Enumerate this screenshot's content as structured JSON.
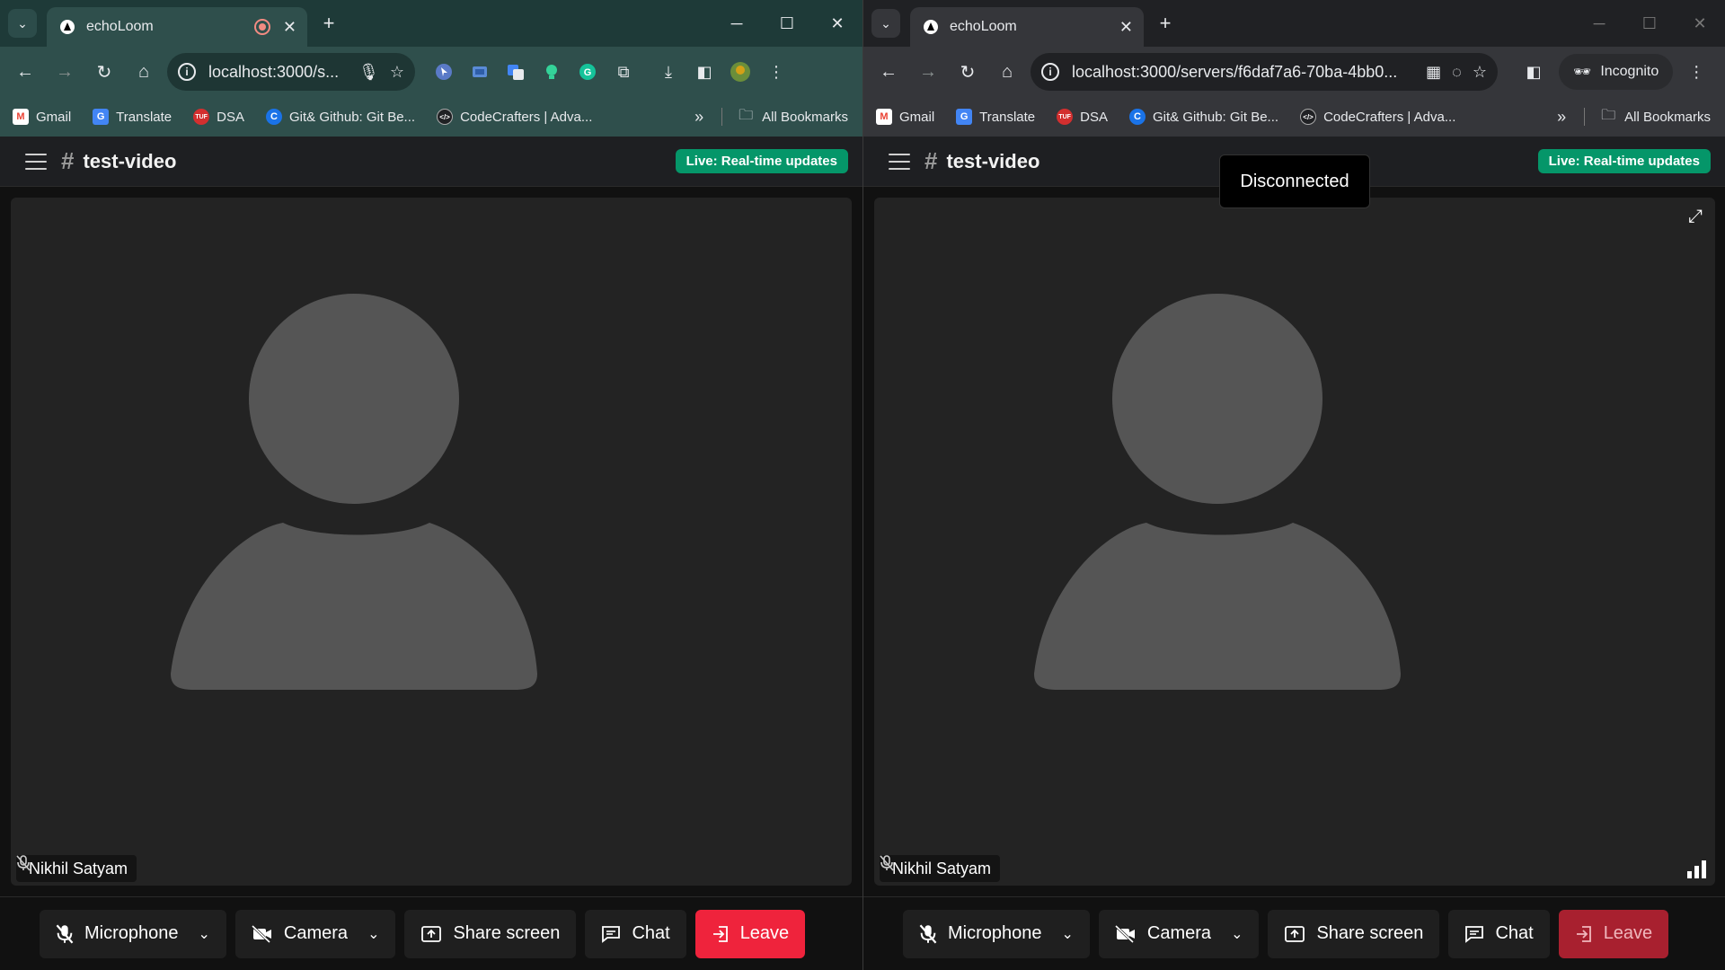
{
  "windows": [
    {
      "id": "left",
      "tab": {
        "title": "echoLoom",
        "recording": true
      },
      "url": "localhost:3000/s...",
      "bookmarks": [
        {
          "label": "Gmail",
          "icon": "gmail-icon",
          "color": "#ea4335"
        },
        {
          "label": "Translate",
          "icon": "translate-icon",
          "color": "#4285f4"
        },
        {
          "label": "DSA",
          "icon": "tuf-icon",
          "color": "#d32f2f"
        },
        {
          "label": "Git& Github: Git Be...",
          "icon": "git-course-icon",
          "color": "#1a73e8"
        },
        {
          "label": "CodeCrafters | Adva...",
          "icon": "codecrafters-icon",
          "color": "#202124"
        }
      ],
      "all_bookmarks": "All Bookmarks",
      "app": {
        "channel": "test-video",
        "live_badge": "Live: Real-time updates",
        "participant": "Nikhil Satyam",
        "toast": null,
        "controls": {
          "microphone": "Microphone",
          "camera": "Camera",
          "share_screen": "Share screen",
          "chat": "Chat",
          "leave": "Leave"
        }
      }
    },
    {
      "id": "right",
      "tab": {
        "title": "echoLoom",
        "recording": false
      },
      "url": "localhost:3000/servers/f6daf7a6-70ba-4bb0...",
      "incognito": "Incognito",
      "bookmarks": [
        {
          "label": "Gmail",
          "icon": "gmail-icon",
          "color": "#ea4335"
        },
        {
          "label": "Translate",
          "icon": "translate-icon",
          "color": "#4285f4"
        },
        {
          "label": "DSA",
          "icon": "tuf-icon",
          "color": "#d32f2f"
        },
        {
          "label": "Git& Github: Git Be...",
          "icon": "git-course-icon",
          "color": "#1a73e8"
        },
        {
          "label": "CodeCrafters | Adva...",
          "icon": "codecrafters-icon",
          "color": "#202124"
        }
      ],
      "all_bookmarks": "All Bookmarks",
      "app": {
        "channel": "test-video",
        "live_badge": "Live: Real-time updates",
        "participant": "Nikhil Satyam",
        "toast": "Disconnected",
        "controls": {
          "microphone": "Microphone",
          "camera": "Camera",
          "share_screen": "Share screen",
          "chat": "Chat",
          "leave": "Leave"
        }
      }
    }
  ],
  "colors": {
    "live_badge": "#059669",
    "leave": "#ef233c",
    "avatar": "#555555",
    "stage": "#232323"
  }
}
